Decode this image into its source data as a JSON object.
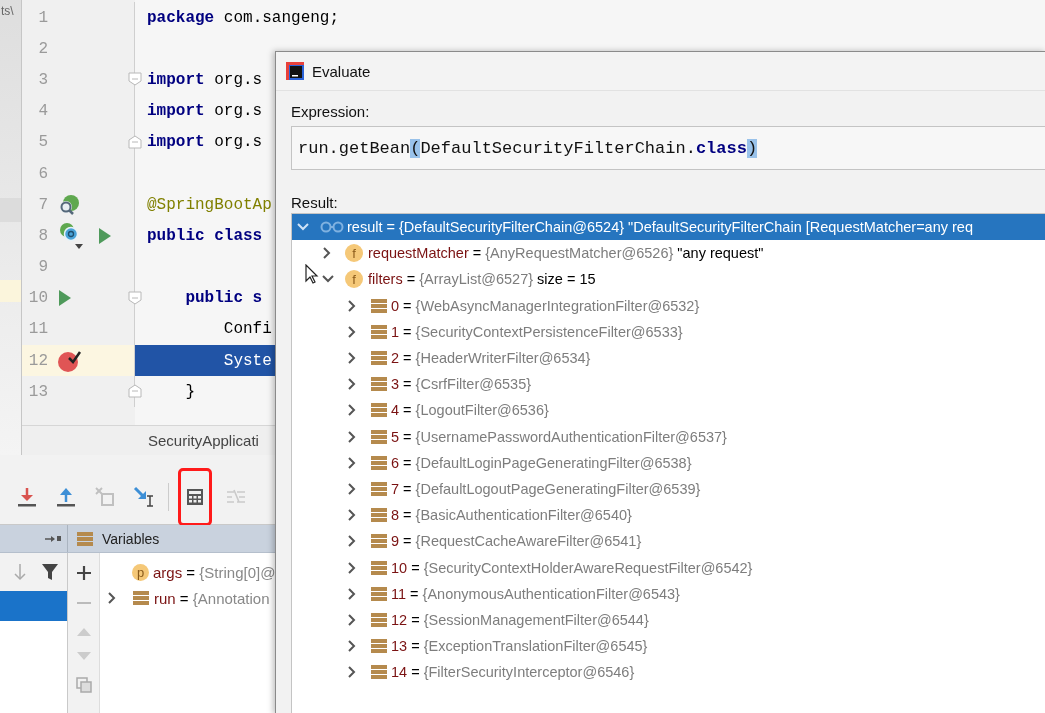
{
  "project_panel": {
    "text": "ts\\"
  },
  "editor": {
    "lines": [
      {
        "number": "1",
        "current": false,
        "tokens": [
          {
            "text": "package",
            "kind": "keyword"
          },
          {
            "text": " com.sangeng;",
            "kind": "plain"
          }
        ]
      },
      {
        "number": "2",
        "current": false
      },
      {
        "number": "3",
        "current": false,
        "fold_start": true,
        "tokens": [
          {
            "text": "import",
            "kind": "keyword"
          },
          {
            "text": " org.s",
            "kind": "plain"
          }
        ]
      },
      {
        "number": "4",
        "current": false,
        "tokens": [
          {
            "text": "import",
            "kind": "keyword"
          },
          {
            "text": " org.s",
            "kind": "plain"
          }
        ]
      },
      {
        "number": "5",
        "current": false,
        "fold_end": true,
        "tokens": [
          {
            "text": "import",
            "kind": "keyword"
          },
          {
            "text": " org.s",
            "kind": "plain"
          }
        ]
      },
      {
        "number": "6",
        "current": false
      },
      {
        "number": "7",
        "current": false,
        "markers": [
          {
            "kind": "bean"
          }
        ],
        "tokens": [
          {
            "text": "@SpringBootAp",
            "kind": "annotation"
          }
        ]
      },
      {
        "number": "8",
        "current": false,
        "markers": [
          {
            "kind": "class"
          },
          {
            "kind": "run"
          }
        ],
        "tokens": [
          {
            "text": "public class",
            "kind": "keyword"
          }
        ]
      },
      {
        "number": "9",
        "current": false
      },
      {
        "number": "10",
        "current": false,
        "fold_start": true,
        "markers": [
          {
            "kind": "run"
          }
        ],
        "tokens": [
          {
            "text": "    public s",
            "kind": "keyword"
          }
        ]
      },
      {
        "number": "11",
        "current": false,
        "tokens": [
          {
            "text": "        Confi",
            "kind": "plain"
          }
        ]
      },
      {
        "number": "12",
        "current": true,
        "markers": [
          {
            "kind": "breakpoint"
          }
        ],
        "tokens": [
          {
            "text": "        Syste",
            "kind": "plain"
          }
        ]
      },
      {
        "number": "13",
        "current": false,
        "fold_end": true,
        "tokens": [
          {
            "text": "    }",
            "kind": "plain"
          }
        ]
      }
    ],
    "tab": "SecurityApplicati"
  },
  "debugger": {
    "toolbar": [
      {
        "kind": "step-into",
        "disabled": false,
        "highlighted": false
      },
      {
        "kind": "step-out",
        "disabled": false,
        "highlighted": false
      },
      {
        "kind": "drop-frame",
        "disabled": true,
        "highlighted": false
      },
      {
        "kind": "run-to-cursor",
        "disabled": false,
        "highlighted": false
      },
      {
        "kind": "evaluate",
        "disabled": false,
        "highlighted": true
      },
      {
        "kind": "trace",
        "disabled": true,
        "highlighted": false
      }
    ],
    "variables_title": "Variables",
    "frames": [
      {
        "selected": true
      }
    ],
    "variables": [
      {
        "kind": "param",
        "badge": "p",
        "name": "args",
        "sep": "=",
        "value": "{String[0]@",
        "has_children": false
      },
      {
        "kind": "object",
        "name": "run",
        "sep": "=",
        "value": "{Annotation",
        "has_children": true,
        "expanded": false
      }
    ]
  },
  "dialog": {
    "title": "Evaluate",
    "expression_label": "Expression:",
    "expression": [
      {
        "text": "run.getBean",
        "kind": "plain"
      },
      {
        "text": "(",
        "kind": "brace"
      },
      {
        "text": "DefaultSecurityFilterChain.",
        "kind": "plain"
      },
      {
        "text": "class",
        "kind": "keyword"
      },
      {
        "text": ")",
        "kind": "brace"
      }
    ],
    "result_label": "Result:",
    "result": [
      {
        "kind": "object",
        "name": "result",
        "sep": "=",
        "value": "{DefaultSecurityFilterChain@6524}",
        "extra": "\"DefaultSecurityFilterChain [RequestMatcher=any req",
        "expanded": true,
        "selected": true,
        "children": [
          {
            "kind": "field",
            "badge": "f",
            "name": "requestMatcher",
            "sep": "=",
            "value": "{AnyRequestMatcher@6526}",
            "extra": "\"any request\"",
            "expanded": false,
            "selected": false
          },
          {
            "kind": "field",
            "badge": "f",
            "name": "filters",
            "sep": "=",
            "value": "{ArrayList@6527}",
            "extra": "size = 15",
            "expanded": true,
            "selected": false,
            "children": [
              {
                "kind": "item",
                "name": "0",
                "sep": "=",
                "value": "{WebAsyncManagerIntegrationFilter@6532}",
                "expanded": false,
                "selected": false
              },
              {
                "kind": "item",
                "name": "1",
                "sep": "=",
                "value": "{SecurityContextPersistenceFilter@6533}",
                "expanded": false,
                "selected": false
              },
              {
                "kind": "item",
                "name": "2",
                "sep": "=",
                "value": "{HeaderWriterFilter@6534}",
                "expanded": false,
                "selected": false
              },
              {
                "kind": "item",
                "name": "3",
                "sep": "=",
                "value": "{CsrfFilter@6535}",
                "expanded": false,
                "selected": false
              },
              {
                "kind": "item",
                "name": "4",
                "sep": "=",
                "value": "{LogoutFilter@6536}",
                "expanded": false,
                "selected": false
              },
              {
                "kind": "item",
                "name": "5",
                "sep": "=",
                "value": "{UsernamePasswordAuthenticationFilter@6537}",
                "expanded": false,
                "selected": false
              },
              {
                "kind": "item",
                "name": "6",
                "sep": "=",
                "value": "{DefaultLoginPageGeneratingFilter@6538}",
                "expanded": false,
                "selected": false
              },
              {
                "kind": "item",
                "name": "7",
                "sep": "=",
                "value": "{DefaultLogoutPageGeneratingFilter@6539}",
                "expanded": false,
                "selected": false
              },
              {
                "kind": "item",
                "name": "8",
                "sep": "=",
                "value": "{BasicAuthenticationFilter@6540}",
                "expanded": false,
                "selected": false
              },
              {
                "kind": "item",
                "name": "9",
                "sep": "=",
                "value": "{RequestCacheAwareFilter@6541}",
                "expanded": false,
                "selected": false
              },
              {
                "kind": "item",
                "name": "10",
                "sep": "=",
                "value": "{SecurityContextHolderAwareRequestFilter@6542}",
                "expanded": false,
                "selected": false
              },
              {
                "kind": "item",
                "name": "11",
                "sep": "=",
                "value": "{AnonymousAuthenticationFilter@6543}",
                "expanded": false,
                "selected": false
              },
              {
                "kind": "item",
                "name": "12",
                "sep": "=",
                "value": "{SessionManagementFilter@6544}",
                "expanded": false,
                "selected": false
              },
              {
                "kind": "item",
                "name": "13",
                "sep": "=",
                "value": "{ExceptionTranslationFilter@6545}",
                "expanded": false,
                "selected": false
              },
              {
                "kind": "item",
                "name": "14",
                "sep": "=",
                "value": "{FilterSecurityInterceptor@6546}",
                "expanded": false,
                "selected": false
              }
            ]
          }
        ]
      }
    ]
  }
}
